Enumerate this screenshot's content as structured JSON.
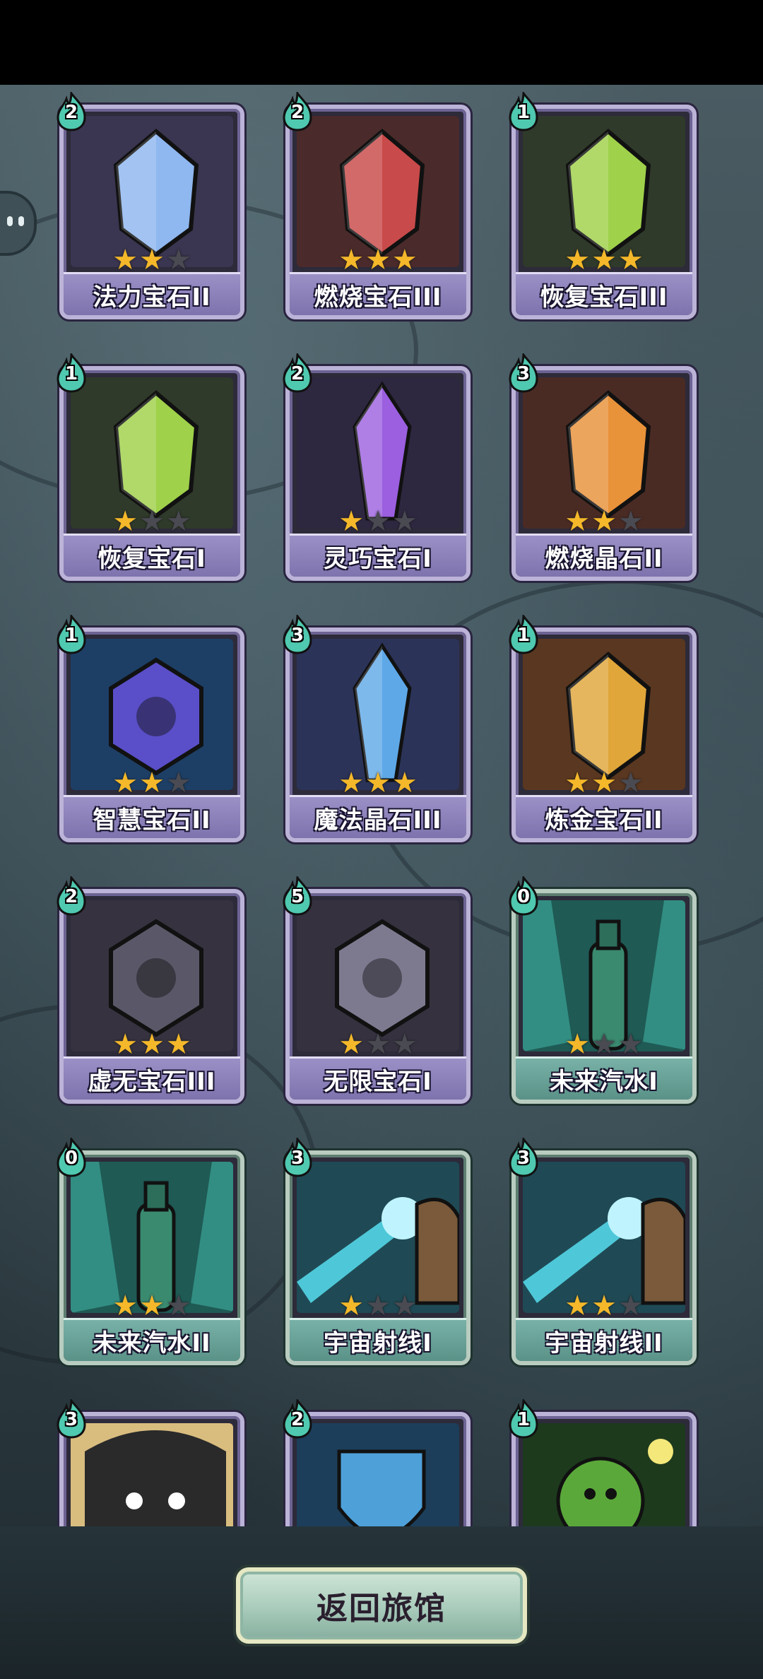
{
  "screen": {
    "return_button": "返回旅馆"
  },
  "cards": [
    {
      "name": "法力宝石II",
      "cost": "2",
      "stars": 2,
      "max_stars": 3,
      "theme": "purple",
      "art": "mana-gem",
      "color": "#8fb7f0"
    },
    {
      "name": "燃烧宝石III",
      "cost": "2",
      "stars": 3,
      "max_stars": 3,
      "theme": "purple",
      "art": "burning-gem",
      "color": "#c94a4a"
    },
    {
      "name": "恢复宝石III",
      "cost": "1",
      "stars": 3,
      "max_stars": 3,
      "theme": "purple",
      "art": "recovery-gem",
      "color": "#9fd14a"
    },
    {
      "name": "恢复宝石I",
      "cost": "1",
      "stars": 1,
      "max_stars": 3,
      "theme": "purple",
      "art": "recovery-gem",
      "color": "#9fd14a"
    },
    {
      "name": "灵巧宝石I",
      "cost": "2",
      "stars": 1,
      "max_stars": 3,
      "theme": "purple",
      "art": "agility-crystal",
      "color": "#9b5fe0"
    },
    {
      "name": "燃烧晶石II",
      "cost": "3",
      "stars": 2,
      "max_stars": 3,
      "theme": "purple",
      "art": "burning-crystal",
      "color": "#e8923a"
    },
    {
      "name": "智慧宝石II",
      "cost": "1",
      "stars": 2,
      "max_stars": 3,
      "theme": "purple",
      "art": "wisdom-gem",
      "color": "#5a4fc8"
    },
    {
      "name": "魔法晶石III",
      "cost": "3",
      "stars": 3,
      "max_stars": 3,
      "theme": "purple",
      "art": "magic-crystal",
      "color": "#5ea8e8"
    },
    {
      "name": "炼金宝石II",
      "cost": "1",
      "stars": 2,
      "max_stars": 3,
      "theme": "purple",
      "art": "alchemy-gem",
      "color": "#e0a63a"
    },
    {
      "name": "虚无宝石III",
      "cost": "2",
      "stars": 3,
      "max_stars": 3,
      "theme": "purple",
      "art": "void-gem",
      "color": "#5a5868"
    },
    {
      "name": "无限宝石I",
      "cost": "5",
      "stars": 1,
      "max_stars": 3,
      "theme": "purple",
      "art": "infinity-gem",
      "color": "#7d7a90"
    },
    {
      "name": "未来汽水I",
      "cost": "0",
      "stars": 1,
      "max_stars": 3,
      "theme": "teal",
      "art": "future-soda",
      "color": "#3a8a70"
    },
    {
      "name": "未来汽水II",
      "cost": "0",
      "stars": 2,
      "max_stars": 3,
      "theme": "teal",
      "art": "future-soda",
      "color": "#3a8a70"
    },
    {
      "name": "宇宙射线I",
      "cost": "3",
      "stars": 1,
      "max_stars": 3,
      "theme": "teal",
      "art": "cosmic-ray",
      "color": "#4ec8d8"
    },
    {
      "name": "宇宙射线II",
      "cost": "3",
      "stars": 2,
      "max_stars": 3,
      "theme": "teal",
      "art": "cosmic-ray",
      "color": "#4ec8d8"
    },
    {
      "name": "",
      "cost": "3",
      "stars": 0,
      "max_stars": 0,
      "theme": "purple",
      "art": "swirl-creature",
      "color": "#e6c88a"
    },
    {
      "name": "",
      "cost": "2",
      "stars": 0,
      "max_stars": 0,
      "theme": "purple",
      "art": "blue-shield",
      "color": "#3a7cb0"
    },
    {
      "name": "",
      "cost": "1",
      "stars": 0,
      "max_stars": 0,
      "theme": "purple",
      "art": "glowing-figure",
      "color": "#7ac43a"
    }
  ]
}
